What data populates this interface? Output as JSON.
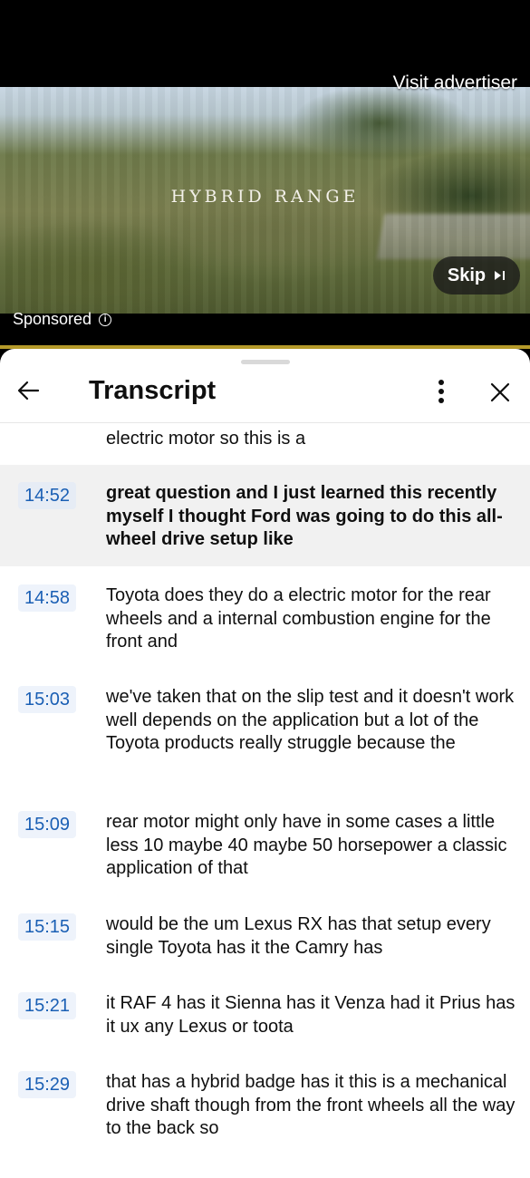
{
  "ad": {
    "title": "HYBRID RANGE",
    "visit_advertiser": "Visit advertiser",
    "skip_label": "Skip",
    "sponsored_label": "Sponsored"
  },
  "transcript": {
    "title": "Transcript",
    "partial_text": "electric motor so this is a",
    "entries": [
      {
        "time": "14:52",
        "text": "great question and I just learned this recently myself I thought Ford was going to do this all-wheel drive setup like",
        "active": true
      },
      {
        "time": "14:58",
        "text": "Toyota does they do a electric motor for the rear wheels and a internal combustion engine for the front and"
      },
      {
        "time": "15:03",
        "text": "we've taken that on the slip test and it doesn't work well depends on the application but a lot of the Toyota products really struggle because the"
      },
      {
        "time": "15:09",
        "text": "rear motor might only have in some cases a little less 10 maybe 40 maybe 50 horsepower a classic application of that"
      },
      {
        "time": "15:15",
        "text": "would be the um Lexus RX has that setup every single Toyota has it the Camry has"
      },
      {
        "time": "15:21",
        "text": "it RAF 4 has it Sienna has it Venza had it Prius has it ux any Lexus or toota"
      },
      {
        "time": "15:29",
        "text": "that has a hybrid badge has it this is a mechanical drive shaft though from the front wheels all the way to the back so"
      }
    ]
  },
  "colors": {
    "timestamp": "#1a5fb4",
    "active_row_bg": "#f1f1f1",
    "progress": "#b59a2a"
  },
  "icons": [
    "back-arrow-icon",
    "more-vert-icon",
    "close-icon",
    "skip-next-icon",
    "info-icon"
  ]
}
